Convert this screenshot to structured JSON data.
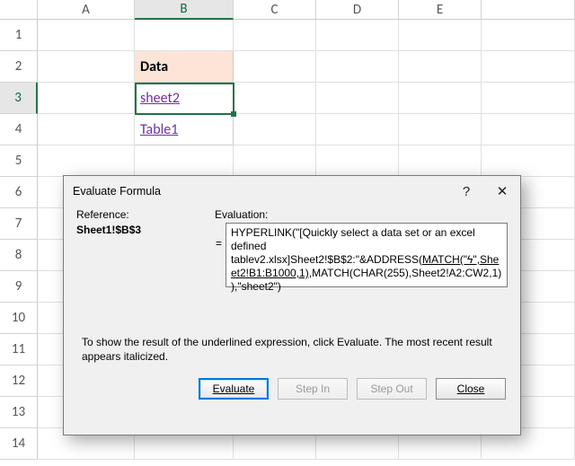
{
  "columns": {
    "A": "A",
    "B": "B",
    "C": "C",
    "D": "D",
    "E": "E"
  },
  "rows": {
    "1": "1",
    "2": "2",
    "3": "3",
    "4": "4",
    "5": "5",
    "6": "6",
    "7": "7",
    "8": "8",
    "9": "9",
    "10": "10",
    "11": "11",
    "12": "12",
    "13": "13",
    "14": "14"
  },
  "sheet": {
    "B2": "Data",
    "B3": "sheet2",
    "B4": "Table1"
  },
  "active_cell": "B3",
  "dialog": {
    "title": "Evaluate Formula",
    "help": "?",
    "close_glyph": "✕",
    "reference_label": "Reference:",
    "reference_value": "Sheet1!$B$3",
    "evaluation_label": "Evaluation:",
    "eq": "=",
    "formula_pre": "HYPERLINK(\"[Quickly select a data set or an excel defined tablev2.xlsx]Sheet2!$B$2:\"&ADDRESS(",
    "formula_u": "MATCH(\"ϟ\",Sheet2!B1:B1000,1)",
    "formula_post": ",MATCH(CHAR(255),Sheet2!A2:CW2,1)),\"sheet2\")",
    "hint": "To show the result of the underlined expression, click Evaluate.  The most recent result appears italicized.",
    "buttons": {
      "evaluate": "Evaluate",
      "step_in": "Step In",
      "step_out": "Step Out",
      "close": "Close"
    }
  }
}
